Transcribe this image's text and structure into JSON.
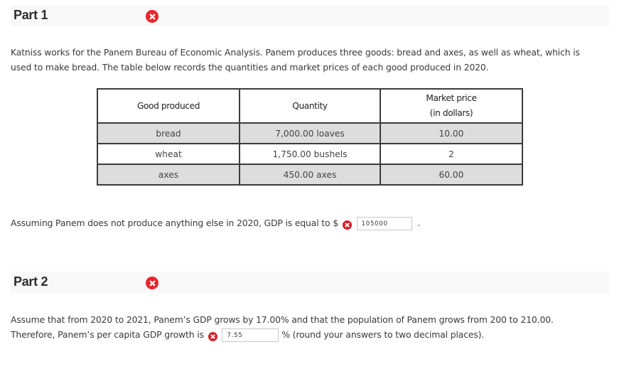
{
  "part1": {
    "title": "Part 1",
    "status_icon": "error-x-icon",
    "intro_line1": "Katniss works for the Panem Bureau of Economic Analysis. Panem produces three goods: bread and axes, as well as wheat, which is",
    "intro_line2": "used to make bread. The table below records the quantities and market prices of each good produced in 2020.",
    "table": {
      "headers": [
        "Good produced",
        "Quantity",
        "Market price",
        "(in dollars)"
      ],
      "rows": [
        {
          "good": "bread",
          "quantity": "7,000.00 loaves",
          "price": "10.00"
        },
        {
          "good": "wheat",
          "quantity": "1,750.00 bushels",
          "price": "2"
        },
        {
          "good": "axes",
          "quantity": "450.00 axes",
          "price": "60.00"
        }
      ]
    },
    "question_prefix": "Assuming Panem does not produce anything else in 2020, GDP is equal to $",
    "answer_value": "105000",
    "question_suffix": "."
  },
  "part2": {
    "title": "Part 2",
    "status_icon": "error-x-icon",
    "line1": "Assume that from 2020 to 2021, Panem’s GDP grows by 17.00% and that the population of Panem grows from 200 to 210.00.",
    "question_prefix": "Therefore, Panem’s per capita GDP growth is",
    "answer_value": "7.55",
    "question_suffix": "% (round your answers to two decimal places)."
  },
  "colors": {
    "error": "#e8262c",
    "header_bar": "#f8f8f8",
    "shaded_row": "#dddddd"
  }
}
